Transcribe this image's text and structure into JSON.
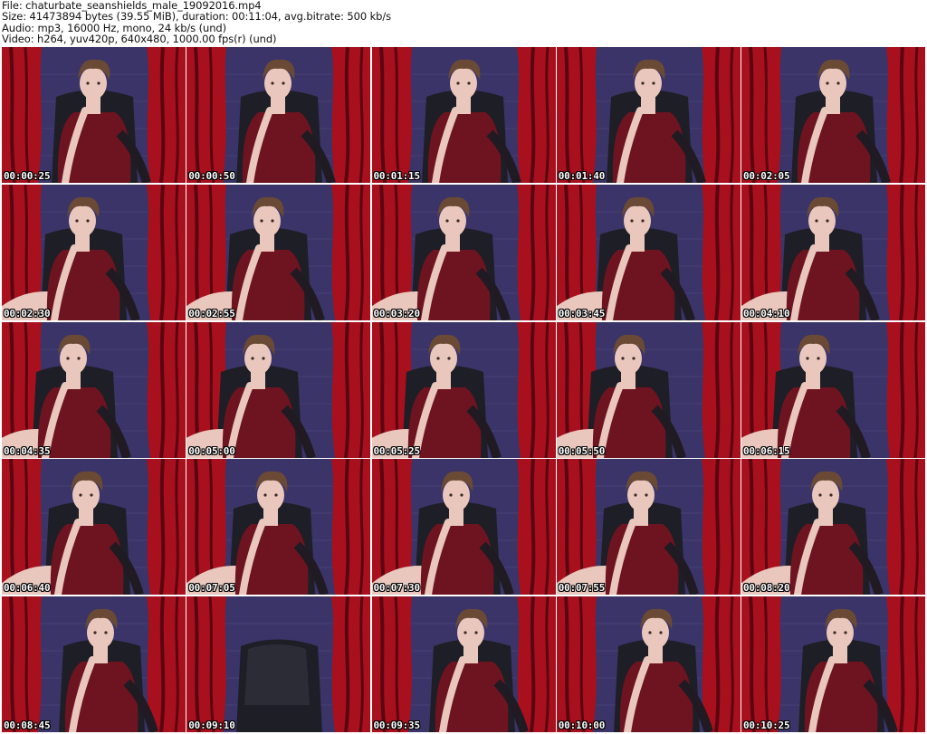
{
  "header": {
    "file": "File: chaturbate_seanshields_male_19092016.mp4",
    "size": "Size: 41473894 bytes (39.55 MiB), duration: 00:11:04, avg.bitrate: 500 kb/s",
    "audio": "Audio: mp3, 16000 Hz, mono, 24 kb/s (und)",
    "video": "Video: h264, yuv420p, 640x480, 1000.00 fps(r) (und)"
  },
  "colors": {
    "curtain": "#a8101e",
    "curtain_dark": "#5a0610",
    "wall": "#3a3468",
    "shirt": "#6e1420",
    "skin": "#e9c7bd",
    "hair": "#6a4a34",
    "chair": "#1e1e26"
  },
  "thumbnails": [
    {
      "time": "00:00:25",
      "variant": 0
    },
    {
      "time": "00:00:50",
      "variant": 0
    },
    {
      "time": "00:01:15",
      "variant": 0
    },
    {
      "time": "00:01:40",
      "variant": 0
    },
    {
      "time": "00:02:05",
      "variant": 0
    },
    {
      "time": "00:02:30",
      "variant": 1
    },
    {
      "time": "00:02:55",
      "variant": 1
    },
    {
      "time": "00:03:20",
      "variant": 1
    },
    {
      "time": "00:03:45",
      "variant": 1
    },
    {
      "time": "00:04:10",
      "variant": 1
    },
    {
      "time": "00:04:35",
      "variant": 2
    },
    {
      "time": "00:05:00",
      "variant": 2
    },
    {
      "time": "00:05:25",
      "variant": 2
    },
    {
      "time": "00:05:50",
      "variant": 2
    },
    {
      "time": "00:06:15",
      "variant": 2
    },
    {
      "time": "00:06:40",
      "variant": 3
    },
    {
      "time": "00:07:05",
      "variant": 3
    },
    {
      "time": "00:07:30",
      "variant": 3
    },
    {
      "time": "00:07:55",
      "variant": 3
    },
    {
      "time": "00:08:20",
      "variant": 3
    },
    {
      "time": "00:08:45",
      "variant": 4
    },
    {
      "time": "00:09:10",
      "variant": 5
    },
    {
      "time": "00:09:35",
      "variant": 4
    },
    {
      "time": "00:10:00",
      "variant": 4
    },
    {
      "time": "00:10:25",
      "variant": 4
    }
  ]
}
